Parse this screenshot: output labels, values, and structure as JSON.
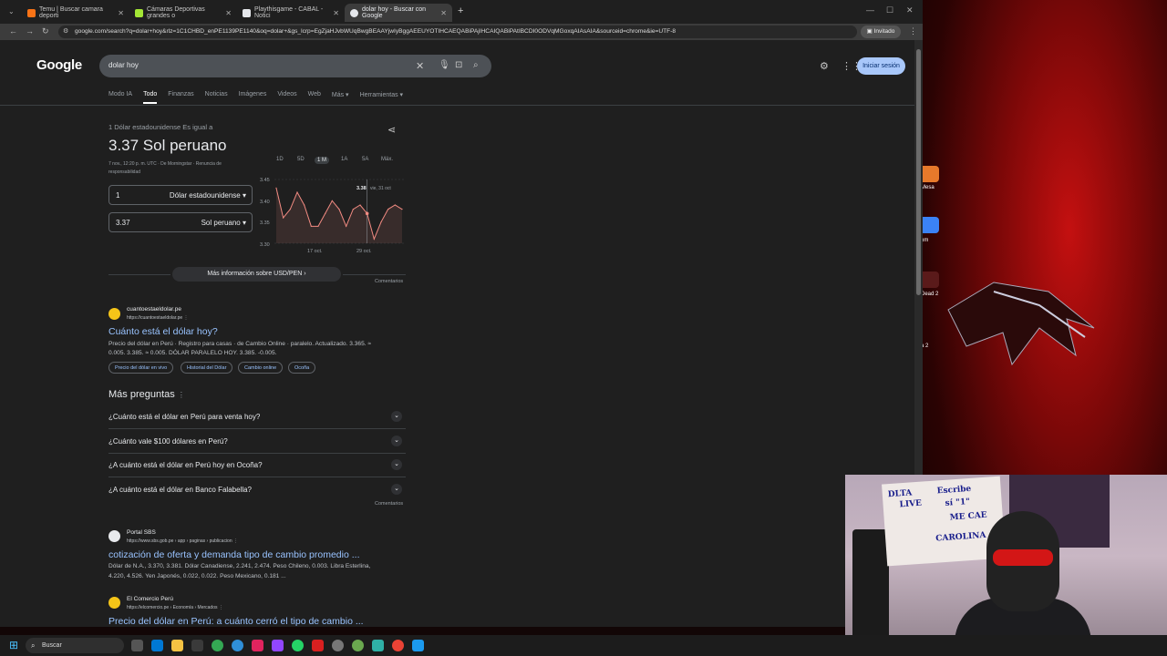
{
  "browser": {
    "tabs": [
      {
        "title": "Temu | Buscar camara deporti",
        "color": "#f97316"
      },
      {
        "title": "Cámaras Deportivas grandes o",
        "color": "#a3e635"
      },
      {
        "title": "Playthisgame - CABAL - Notici",
        "color": "#e5e7eb"
      },
      {
        "title": "dolar hoy - Buscar con Google",
        "color": "#e5e7eb"
      }
    ],
    "url": "google.com/search?q=dolar+hoy&rlz=1C1CHBD_enPE1139PE1140&oq=dolar+&gs_lcrp=EgZjaHJvbWUqBwgBEAAYjwIyBggAEEUYOTIHCAEQABiPAjIHCAIQABiPAtIBCDI0ODVqMGoxqAIAsAIA&sourceid=chrome&ie=UTF-8",
    "profile": "Invitado"
  },
  "google": {
    "logo": "Google",
    "query": "dolar hoy",
    "signin": "Iniciar sesión",
    "filters": [
      "Modo IA",
      "Todo",
      "Finanzas",
      "Noticias",
      "Imágenes",
      "Videos",
      "Web",
      "Más ▾",
      "Herramientas ▾"
    ]
  },
  "converter": {
    "label": "1 Dólar estadounidense Es igual a",
    "result": "3.37 Sol peruano",
    "meta1": "7 nov., 12:20 p. m. UTC · De Morningstar · Renuncia de",
    "meta2": "responsabilidad",
    "from_value": "1",
    "from_unit": "Dólar estadounidense",
    "to_value": "3.37",
    "to_unit": "Sol peruano",
    "more": "Más información sobre USD/PEN",
    "feedback": "Comentarios"
  },
  "chart_data": {
    "type": "line",
    "ranges": [
      "1D",
      "5D",
      "1 M",
      "1A",
      "5A",
      "Máx."
    ],
    "active_range": "1 M",
    "y_ticks": [
      "3.45",
      "3.40",
      "3.35",
      "3.30"
    ],
    "ylim": [
      3.3,
      3.45
    ],
    "x_labels": [
      "17 oct.",
      "29 oct."
    ],
    "values": [
      3.43,
      3.36,
      3.38,
      3.42,
      3.39,
      3.34,
      3.34,
      3.37,
      3.4,
      3.38,
      3.34,
      3.38,
      3.39,
      3.37,
      3.31,
      3.35,
      3.38,
      3.39,
      3.38
    ],
    "tooltip_value": "3.38",
    "tooltip_date": "vie, 31 oct",
    "color": "#f28b82"
  },
  "result1": {
    "site": "cuantoestaeldolar.pe",
    "url": "https://cuantoestaeldolar.pe",
    "title": "Cuánto está el dólar hoy?",
    "snippet1": "Precio del dólar en Perú · Registro para casas · de Cambio Online · paralelo. Actualizado. 3.365. ≈",
    "snippet2": "0.005. 3.385. ≈ 0.005. DÓLAR PARALELO HOY. 3.385. -0.005.",
    "chips": [
      "Precio del dólar en vivo",
      "Historial del Dólar",
      "Cambio online",
      "Ocoña"
    ]
  },
  "paa": {
    "heading": "Más preguntas",
    "questions": [
      "¿Cuánto está el dólar en Perú para venta hoy?",
      "¿Cuánto vale $100 dólares en Perú?",
      "¿A cuánto está el dólar en Perú hoy en Ocoña?",
      "¿A cuánto está el dólar en Banco Falabella?"
    ],
    "feedback": "Comentarios"
  },
  "result2": {
    "site": "Portal SBS",
    "url": "https://www.sbs.gob.pe › app › paginas › publicacion",
    "title": "cotización de oferta y demanda tipo de cambio promedio ...",
    "snippet1": "Dólar de N.A., 3.370, 3.381. Dólar Canadiense, 2.241, 2.474. Peso Chileno, 0.003. Libra Esterlina,",
    "snippet2": "4.220, 4.526. Yen Japonés, 0.022, 0.022. Peso Mexicano, 0.181 ..."
  },
  "result3": {
    "site": "El Comercio Perú",
    "url": "https://elcomercio.pe › Economía › Mercados",
    "title": "Precio del dólar en Perú: a cuánto cerró el tipo de cambio ..."
  },
  "taskbar": {
    "search": "Buscar"
  },
  "desktop": {
    "labels": [
      "Mesa",
      "om",
      "Dead 2",
      "a 2"
    ]
  },
  "webcam": {
    "board_lines": [
      "DLTA",
      "LIVE",
      "CAROLINA",
      "Escribe",
      "sí \"1\"",
      "ME CAE"
    ]
  }
}
